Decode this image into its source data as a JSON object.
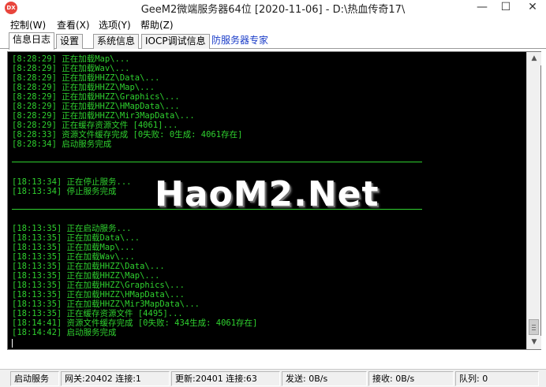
{
  "window": {
    "icon_text": "DX",
    "title": "GeeM2微端服务器64位 [2020-11-06] - D:\\热血传奇17\\",
    "minimize_glyph": "—",
    "maximize_glyph": "☐",
    "close_glyph": "✕"
  },
  "menu": [
    {
      "label": "控制(W)"
    },
    {
      "label": "查看(X)"
    },
    {
      "label": "选项(Y)"
    },
    {
      "label": "帮助(Z)"
    }
  ],
  "tabs": [
    {
      "label": "信息日志",
      "active": true
    },
    {
      "label": "设置",
      "active": false
    },
    {
      "label": "系统信息",
      "active": false
    },
    {
      "label": "IOCP调试信息",
      "active": false
    }
  ],
  "tab_link": {
    "label": "防服务器专家"
  },
  "log": {
    "text_color": "#2fd12f",
    "background": "#000000",
    "lines": [
      "[8:28:29] 正在加载Map\\...",
      "[8:28:29] 正在加载Wav\\...",
      "[8:28:29] 正在加载HHZZ\\Data\\...",
      "[8:28:29] 正在加载HHZZ\\Map\\...",
      "[8:28:29] 正在加载HHZZ\\Graphics\\...",
      "[8:28:29] 正在加载HHZZ\\HMapData\\...",
      "[8:28:29] 正在加载HHZZ\\Mir3MapData\\...",
      "[8:28:29] 正在缓存资源文件 [4061]...",
      "[8:28:33] 资源文件缓存完成 [0失败: 0生成: 4061存在]",
      "[8:28:34] 启动服务完成",
      "",
      "",
      "[18:13:34] 正在停止服务...",
      "[18:13:34] 停止服务完成",
      "",
      "",
      "[18:13:35] 正在启动服务...",
      "[18:13:35] 正在加载Data\\...",
      "[18:13:35] 正在加载Map\\...",
      "[18:13:35] 正在加载Wav\\...",
      "[18:13:35] 正在加载HHZZ\\Data\\...",
      "[18:13:35] 正在加载HHZZ\\Map\\...",
      "[18:13:35] 正在加载HHZZ\\Graphics\\...",
      "[18:13:35] 正在加载HHZZ\\HMapData\\...",
      "[18:13:35] 正在加载HHZZ\\Mir3MapData\\...",
      "[18:13:35] 正在缓存资源文件 [4495]...",
      "[18:14:41] 资源文件缓存完成 [0失败: 434生成: 4061存在]",
      "[18:14:42] 启动服务完成"
    ]
  },
  "watermark": "HaoM2.Net",
  "scrollbar": {
    "up_glyph": "▲",
    "down_glyph": "▼"
  },
  "status": [
    {
      "label": "启动服务"
    },
    {
      "label": "网关:20402  连接:1"
    },
    {
      "label": "更新:20401  连接:63"
    },
    {
      "label": "发送: 0B/s"
    },
    {
      "label": "接收: 0B/s"
    },
    {
      "label": "队列: 0"
    }
  ]
}
